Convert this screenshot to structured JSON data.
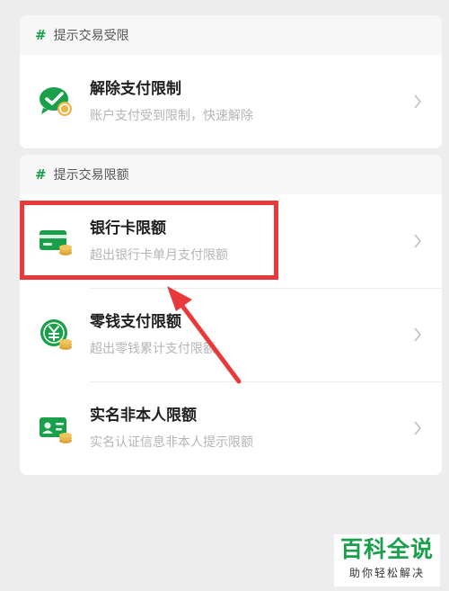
{
  "section1": {
    "header_hash": "#",
    "header": "提示交易受限",
    "items": [
      {
        "title": "解除支付限制",
        "subtitle": "账户支付受到限制，快速解除",
        "icon": "check-bubble-icon"
      }
    ]
  },
  "section2": {
    "header_hash": "#",
    "header": "提示交易限额",
    "items": [
      {
        "title": "银行卡限额",
        "subtitle": "超出银行卡单月支付限额",
        "icon": "bank-card-icon"
      },
      {
        "title": "零钱支付限额",
        "subtitle": "超出零钱累计支付限额",
        "icon": "yuan-coin-icon"
      },
      {
        "title": "实名非本人限额",
        "subtitle": "实名认证信息非本人提示限额",
        "icon": "id-card-icon"
      }
    ]
  },
  "watermark": {
    "main": "百科全说",
    "sub": "助你轻松解决"
  },
  "colors": {
    "accent_green": "#1a9f4a",
    "highlight_red": "#e83a3a",
    "coin_gold": "#e8b64a"
  }
}
